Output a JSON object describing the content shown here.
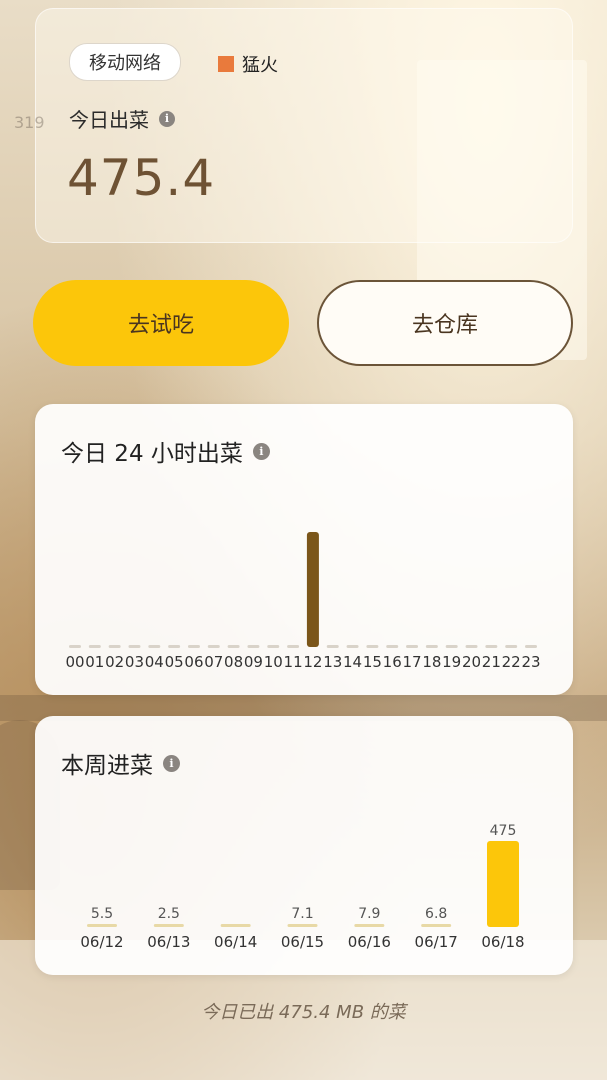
{
  "header": {
    "network_label": "移动网络",
    "legend_label": "猛火",
    "legend_color": "#e97a3c",
    "ghost_text": "319",
    "title": "今日出菜",
    "value": "475.4",
    "info_icon": "info-icon"
  },
  "actions": {
    "try_label": "去试吃",
    "warehouse_label": "去仓库"
  },
  "hourly": {
    "title": "今日 24 小时出菜",
    "chart_data": {
      "type": "bar",
      "categories": [
        "00",
        "01",
        "02",
        "03",
        "04",
        "05",
        "06",
        "07",
        "08",
        "09",
        "10",
        "11",
        "12",
        "13",
        "14",
        "15",
        "16",
        "17",
        "18",
        "19",
        "20",
        "21",
        "22",
        "23"
      ],
      "values": [
        0,
        0,
        0,
        0,
        0,
        0,
        0,
        0,
        0,
        0,
        0,
        0,
        475.4,
        0,
        0,
        0,
        0,
        0,
        0,
        0,
        0,
        0,
        0,
        0
      ],
      "bar_color": "#7b561a",
      "empty_color": "#d9d3c9",
      "grid": false
    }
  },
  "weekly": {
    "title": "本周进菜",
    "chart_data": {
      "type": "bar",
      "categories": [
        "06/12",
        "06/13",
        "06/14",
        "06/15",
        "06/16",
        "06/17",
        "06/18"
      ],
      "values": [
        5.5,
        2.5,
        0,
        7.1,
        7.9,
        6.8,
        475
      ],
      "labels": [
        "5.5",
        "2.5",
        "",
        "7.1",
        "7.9",
        "6.8",
        "475"
      ],
      "bar_color": "#fcc60a",
      "small_color": "#e8d9a6",
      "grid": false
    }
  },
  "footer": {
    "text": "今日已出 475.4 MB 的菜"
  }
}
